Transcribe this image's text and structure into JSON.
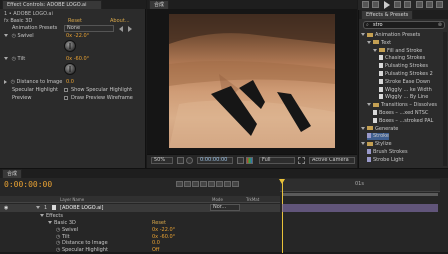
{
  "effect_controls": {
    "tab": "Effect Controls: ADOBE LOGO.ai",
    "layer_label": "1 • ADOBE LOGO.ai",
    "effect_name": "Basic 3D",
    "reset": "Reset",
    "about": "About...",
    "animation_presets_label": "Animation Presets",
    "animation_presets_value": "None",
    "swivel_label": "Swivel",
    "swivel_value": "0x -22.0°",
    "tilt_label": "Tilt",
    "tilt_value": "0x -60.0°",
    "distance_label": "Distance to Image",
    "distance_value": "0.0",
    "specular_label": "Specular Highlight",
    "specular_check": "Show Specular Highlight",
    "preview_label": "Preview",
    "preview_check": "Draw Preview Wireframe"
  },
  "composition": {
    "tab": "合成",
    "zoom": "50%",
    "timecode": "0:00:00:00",
    "resolution": "Full",
    "camera": "Active Camera"
  },
  "effects_presets": {
    "tab": "Effects & Presets",
    "search_value": "stro",
    "tree": [
      {
        "label": "Animation Presets",
        "type": "folder",
        "depth": 0
      },
      {
        "label": "Text",
        "type": "folder",
        "depth": 1
      },
      {
        "label": "Fill and Stroke",
        "type": "folder",
        "depth": 2
      },
      {
        "label": "Chasing Strokes",
        "type": "doc",
        "depth": 3
      },
      {
        "label": "Pulsating Strokes",
        "type": "doc",
        "depth": 3
      },
      {
        "label": "Pulsating Strokes 2",
        "type": "doc",
        "depth": 3
      },
      {
        "label": "Stroke Ease Down",
        "type": "doc",
        "depth": 3
      },
      {
        "label": "Wiggly ... ke Width",
        "type": "doc",
        "depth": 3
      },
      {
        "label": "Wiggly ... By Line",
        "type": "doc",
        "depth": 3
      },
      {
        "label": "Transitions – Dissolves",
        "type": "folder",
        "depth": 1
      },
      {
        "label": "Boxes – ...xed NTSC",
        "type": "doc",
        "depth": 2
      },
      {
        "label": "Boxes – ...stroked PAL",
        "type": "doc",
        "depth": 2
      },
      {
        "label": "Generate",
        "type": "folder",
        "depth": 0
      },
      {
        "label": "Stroke",
        "type": "fx",
        "depth": 1,
        "selected": true
      },
      {
        "label": "Stylize",
        "type": "folder",
        "depth": 0
      },
      {
        "label": "Brush Strokes",
        "type": "fx",
        "depth": 1
      },
      {
        "label": "Strobe Light",
        "type": "fx",
        "depth": 1
      }
    ]
  },
  "timeline": {
    "tab": "合成",
    "timecode": "0:00:00:00",
    "col_layer_name": "Layer Name",
    "col_mode": "Mode",
    "col_trkmat": "TrkMat",
    "ruler_label": "01s",
    "layer_num": "1",
    "layer_name": "[ADOBE LOGO.ai]",
    "mode_value": "Nor...",
    "effects": "Effects",
    "effect_name": "Basic 3D",
    "reset": "Reset",
    "props": [
      {
        "label": "Swivel",
        "value": "0x -22.0°"
      },
      {
        "label": "Tilt",
        "value": "0x -60.0°"
      },
      {
        "label": "Distance to Image",
        "value": "0.0"
      },
      {
        "label": "Specular Highlight",
        "value": "Off"
      }
    ]
  }
}
